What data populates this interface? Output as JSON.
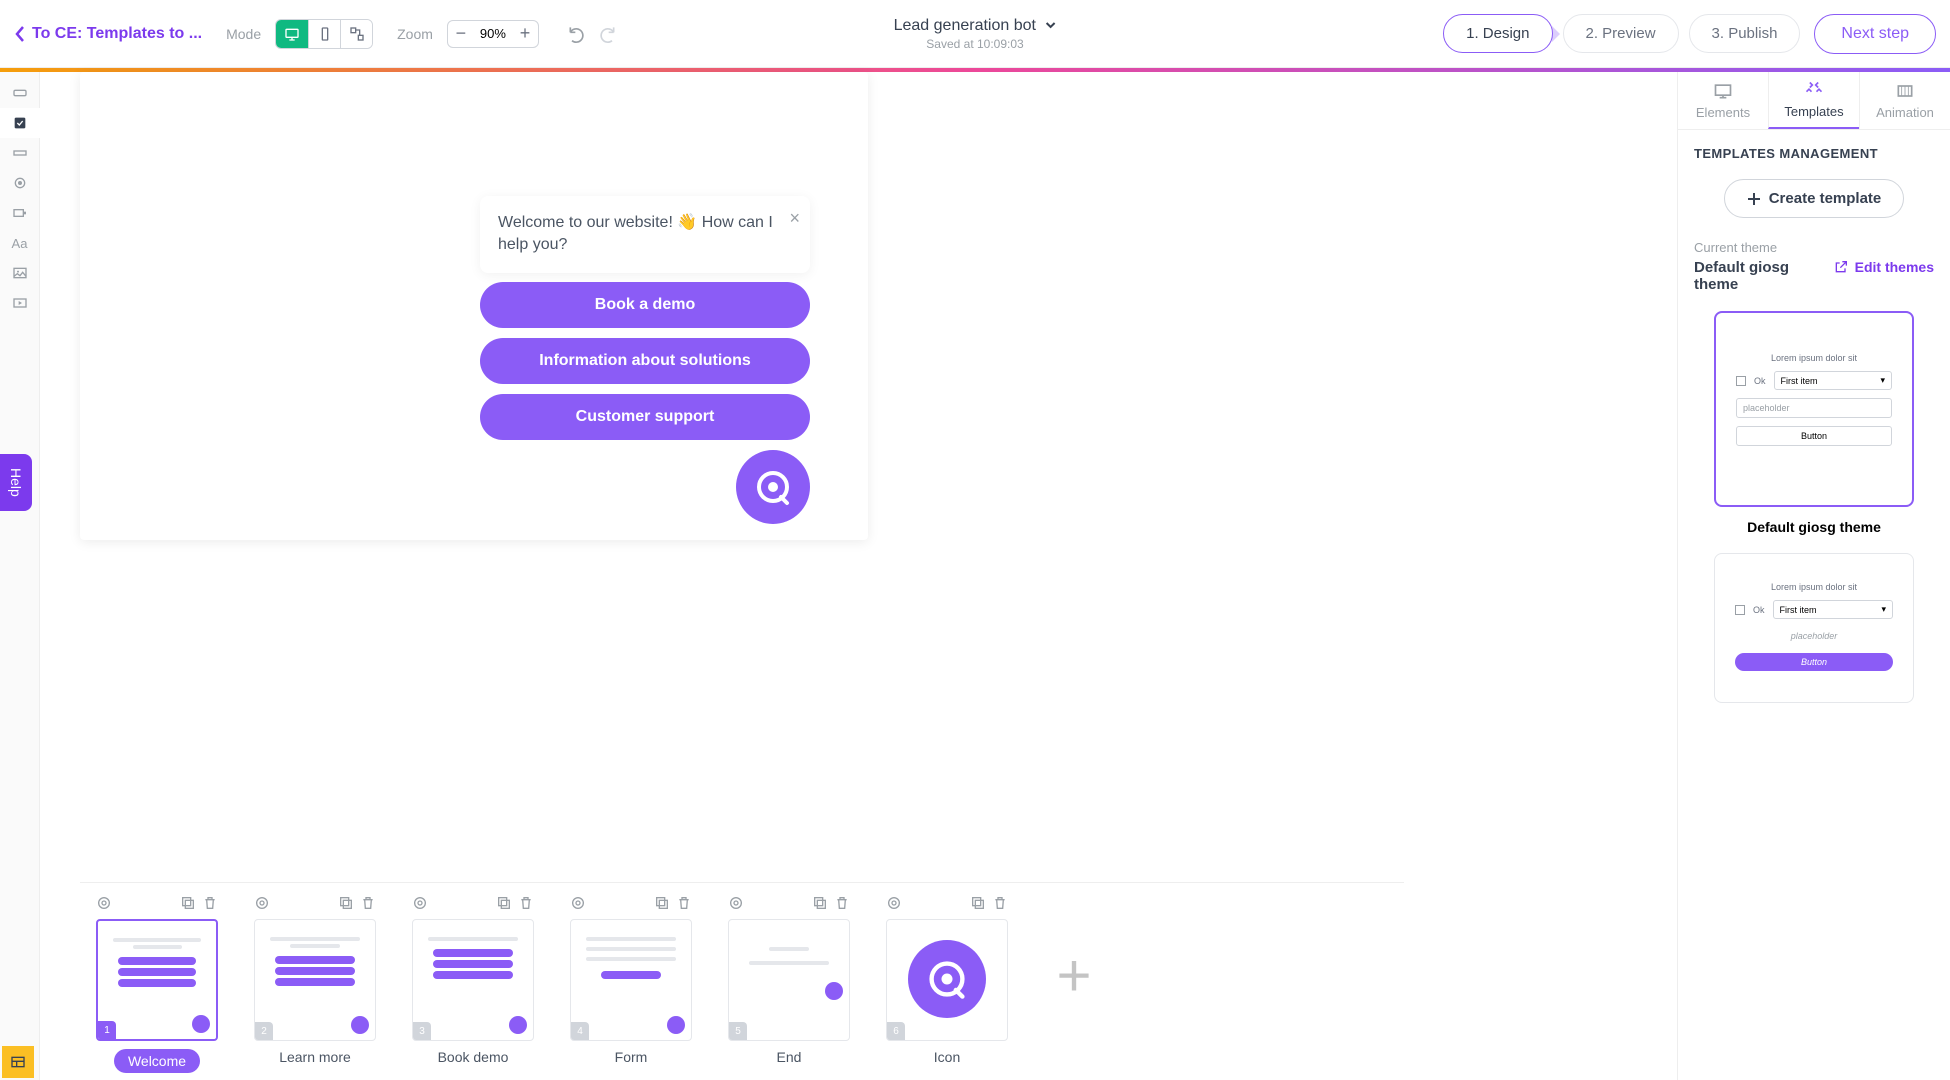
{
  "header": {
    "back_label": "To CE: Templates to ...",
    "mode_label": "Mode",
    "zoom_label": "Zoom",
    "zoom_value": "90%",
    "title": "Lead generation bot",
    "saved": "Saved at 10:09:03",
    "steps": [
      "1. Design",
      "2. Preview",
      "3. Publish"
    ],
    "next_step": "Next step"
  },
  "chat": {
    "message": "Welcome to our website! 👋 How can I help you?",
    "buttons": [
      "Book a demo",
      "Information about solutions",
      "Customer support"
    ]
  },
  "slides": [
    {
      "num": "1",
      "label": "Welcome"
    },
    {
      "num": "2",
      "label": "Learn more"
    },
    {
      "num": "3",
      "label": "Book demo"
    },
    {
      "num": "4",
      "label": "Form"
    },
    {
      "num": "5",
      "label": "End"
    },
    {
      "num": "6",
      "label": "Icon"
    }
  ],
  "panel": {
    "tabs": [
      "Elements",
      "Templates",
      "Animation"
    ],
    "heading": "TEMPLATES MANAGEMENT",
    "create": "Create template",
    "current_label": "Current theme",
    "current_name": "Default giosg theme",
    "edit_themes": "Edit themes",
    "card": {
      "text": "Lorem ipsum dolor sit",
      "ok": "Ok",
      "sel": "First item",
      "ph": "placeholder",
      "btn": "Button"
    },
    "theme_name": "Default giosg theme"
  },
  "help_label": "Help"
}
